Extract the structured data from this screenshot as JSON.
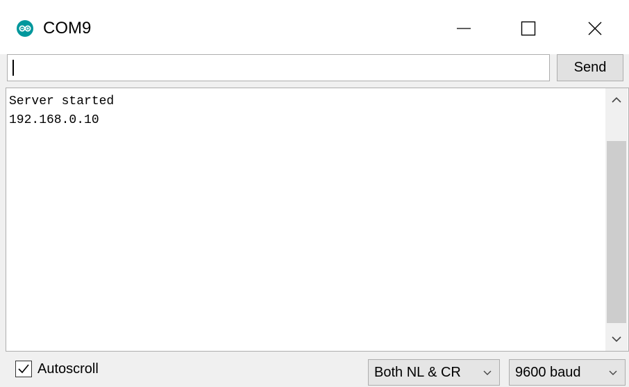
{
  "window": {
    "title": "COM9",
    "app_icon": "arduino-logo-icon",
    "controls": [
      "minimize-icon",
      "maximize-icon",
      "close-icon"
    ]
  },
  "send_bar": {
    "input_value": "",
    "send_label": "Send"
  },
  "output": {
    "lines": [
      "Server started",
      "192.168.0.10"
    ]
  },
  "scrollbar": {
    "up_icon": "chevron-up-icon",
    "down_icon": "chevron-down-icon"
  },
  "footer": {
    "autoscroll_label": "Autoscroll",
    "autoscroll_checked": true,
    "line_ending_selected": "Both NL & CR",
    "baud_selected": "9600 baud"
  },
  "colors": {
    "accent": "#00979c",
    "window_bg": "#f0f0f0",
    "border": "#adadad"
  }
}
